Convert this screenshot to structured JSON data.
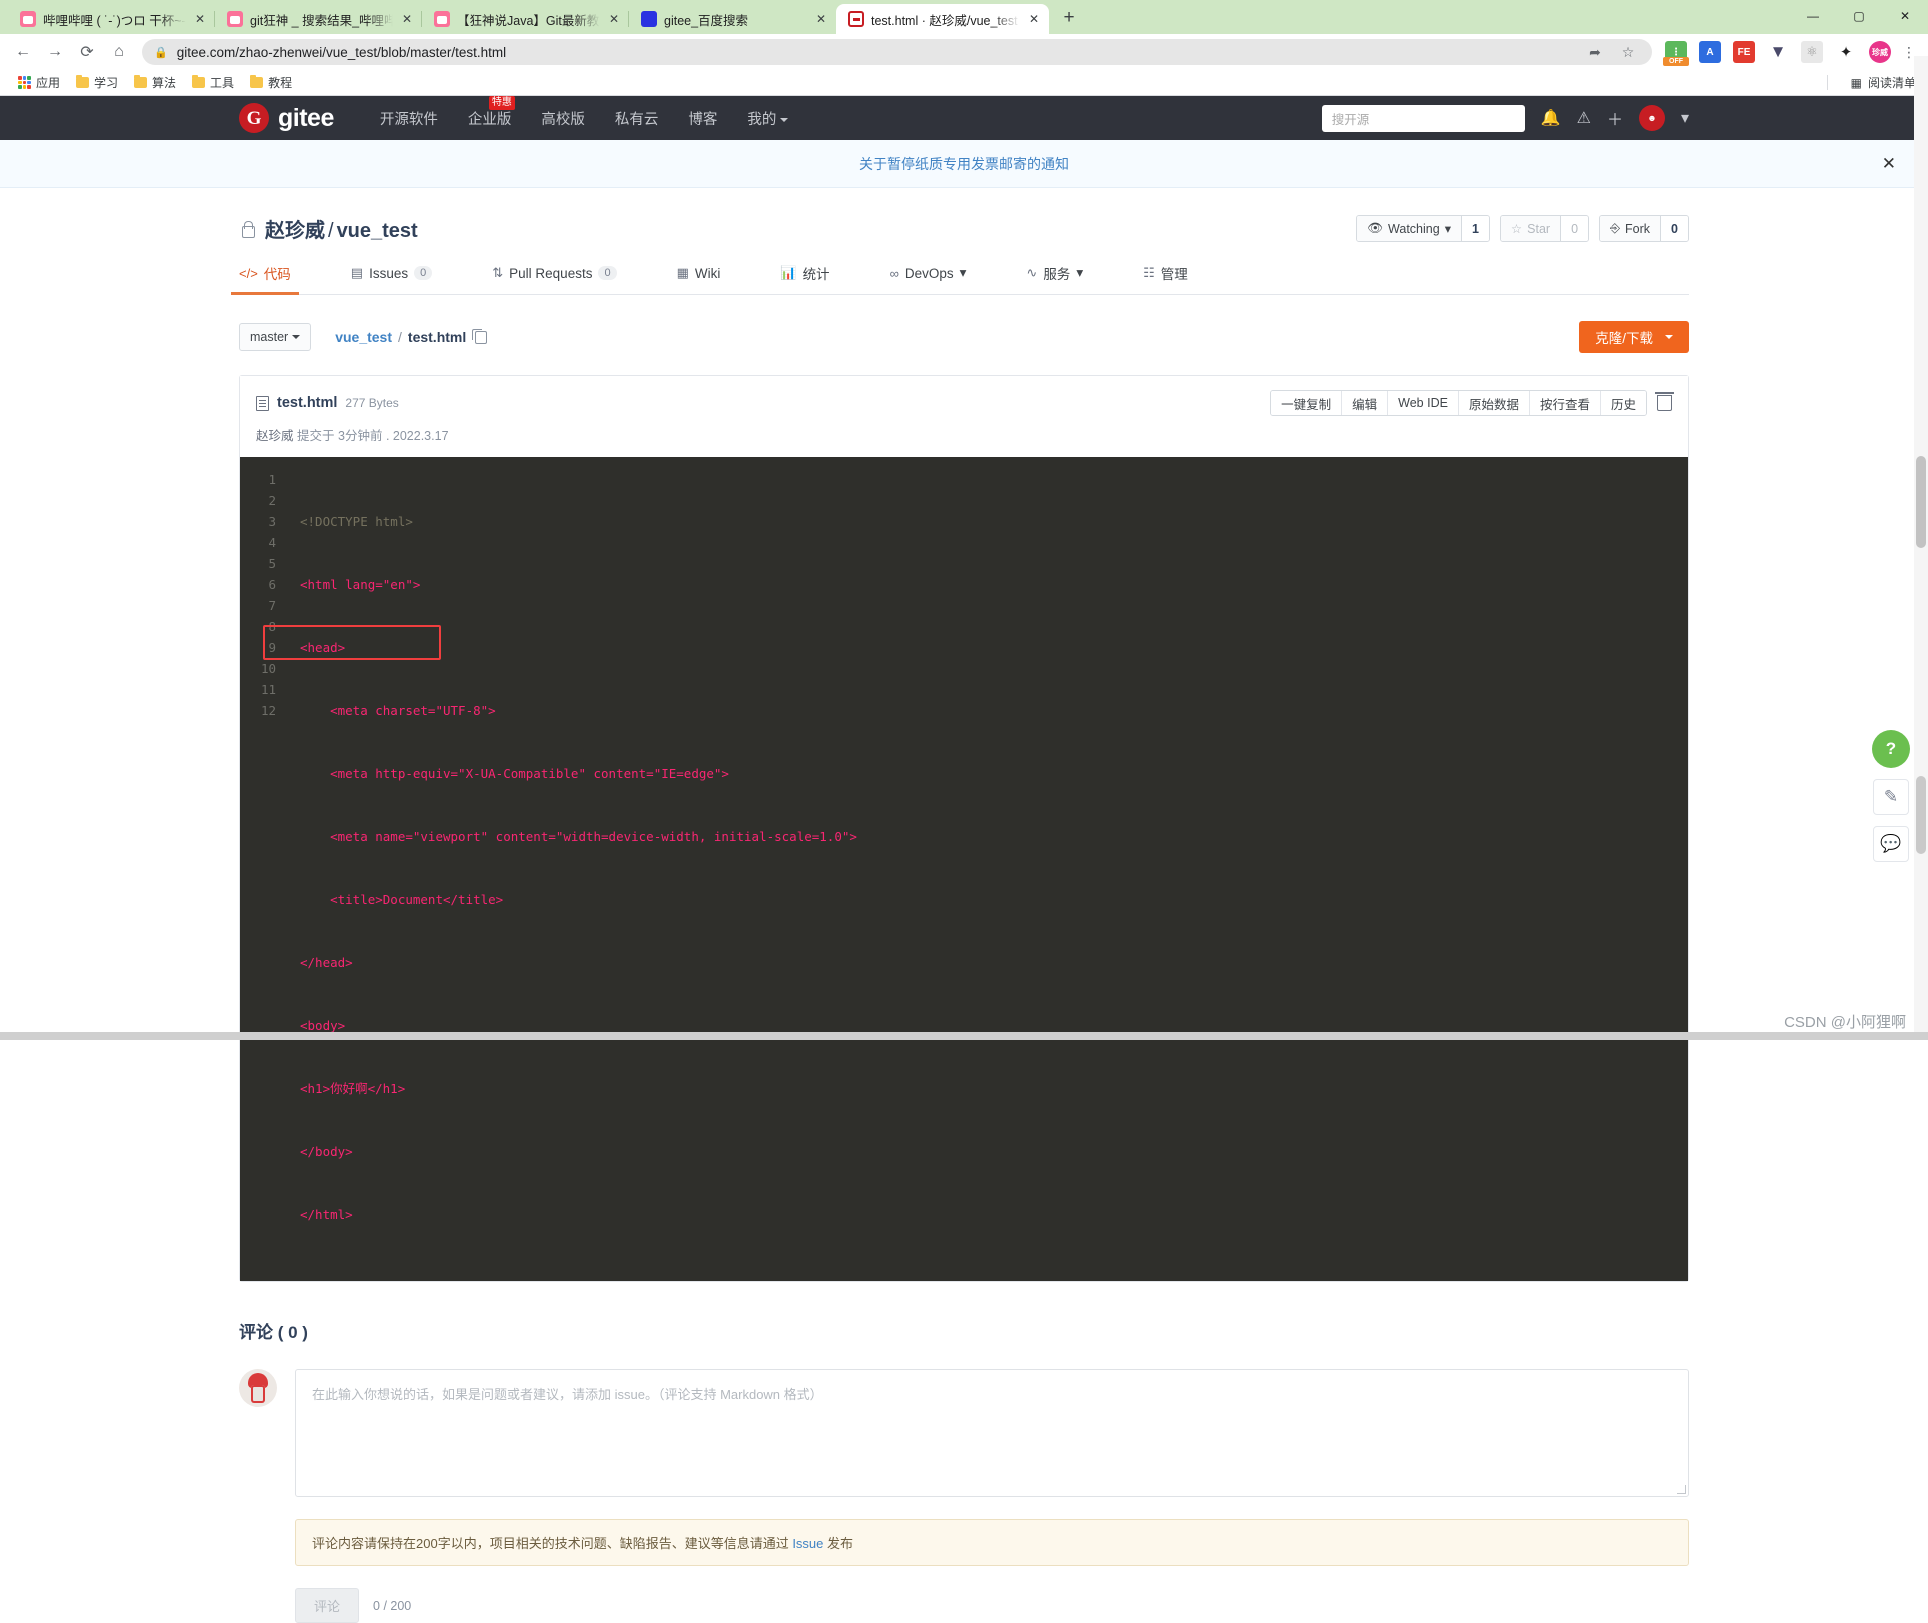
{
  "browser": {
    "tabs": [
      {
        "title": "哔哩哔哩 ( ˙-˙)つロ 干杯~-bili",
        "favicon": "bilibili-icon",
        "active": false
      },
      {
        "title": "git狂神 _ 搜索结果_哔哩哔哩_Bil",
        "favicon": "bilibili-icon",
        "active": false
      },
      {
        "title": "【狂神说Java】Git最新教程通俗",
        "favicon": "bilibili-icon",
        "active": false
      },
      {
        "title": "gitee_百度搜索",
        "favicon": "baidu-icon",
        "active": false
      },
      {
        "title": "test.html · 赵珍威/vue_test - 码",
        "favicon": "gitee-icon",
        "active": true
      }
    ],
    "new_tab_label": "+",
    "close_label": "✕",
    "window_buttons": [
      "—",
      "▢",
      "✕"
    ],
    "nav": {
      "back": "←",
      "forward": "→",
      "reload": "⟳",
      "home": "⌂"
    },
    "omnibox": {
      "lock": "🔒",
      "url": "gitee.com/zhao-zhenwei/vue_test/blob/master/test.html",
      "share": "share-icon",
      "star": "☆"
    },
    "extensions": [
      "off-badge-extension",
      "A-extension",
      "FE-extension",
      "V-extension",
      "atom-extension",
      "puzzle-extension"
    ],
    "profile_label": "珍威",
    "menu_label": "⋮",
    "bookmarks": [
      {
        "label": "应用",
        "icon": "apps-grid-icon"
      },
      {
        "label": "学习",
        "icon": "folder-icon"
      },
      {
        "label": "算法",
        "icon": "folder-icon"
      },
      {
        "label": "工具",
        "icon": "folder-icon"
      },
      {
        "label": "教程",
        "icon": "folder-icon"
      }
    ],
    "reading_list": "阅读清单"
  },
  "gitee_nav": {
    "brand": "gitee",
    "brand_mark": "G",
    "links": [
      {
        "label": "开源软件",
        "badge": ""
      },
      {
        "label": "企业版",
        "badge": "特惠"
      },
      {
        "label": "高校版",
        "badge": ""
      },
      {
        "label": "私有云",
        "badge": ""
      },
      {
        "label": "博客",
        "badge": ""
      },
      {
        "label": "我的",
        "badge": "",
        "has_caret": true
      }
    ],
    "search_placeholder": "搜开源",
    "icons": [
      "bell-icon",
      "message-icon",
      "plus-icon",
      "avatar-icon"
    ],
    "avatar_caret": "▾"
  },
  "notice": {
    "text": "关于暂停纸质专用发票邮寄的通知",
    "close": "✕"
  },
  "repo": {
    "owner": "赵珍威",
    "separator": "/",
    "name": "vue_test",
    "lock_icon": "lock-icon",
    "actions": [
      {
        "name": "watching",
        "icon": "eye-icon",
        "label": "Watching",
        "caret": "▾",
        "count": "1",
        "muted": false
      },
      {
        "name": "star",
        "icon": "☆",
        "label": "Star",
        "count": "0",
        "muted": true
      },
      {
        "name": "fork",
        "icon": "fork-icon",
        "label": "Fork",
        "count": "0",
        "muted": false
      }
    ],
    "tabs": [
      {
        "label": "代码",
        "icon": "code-icon",
        "count": "",
        "active": true
      },
      {
        "label": "Issues",
        "icon": "issue-icon",
        "count": "0",
        "active": false
      },
      {
        "label": "Pull Requests",
        "icon": "pr-icon",
        "count": "0",
        "active": false
      },
      {
        "label": "Wiki",
        "icon": "wiki-icon",
        "count": "",
        "active": false
      },
      {
        "label": "统计",
        "icon": "chart-icon",
        "count": "",
        "active": false
      },
      {
        "label": "DevOps",
        "icon": "devops-icon",
        "count": "",
        "caret": "▾",
        "active": false
      },
      {
        "label": "服务",
        "icon": "service-icon",
        "count": "",
        "caret": "▾",
        "active": false
      },
      {
        "label": "管理",
        "icon": "manage-icon",
        "count": "",
        "active": false
      }
    ]
  },
  "file_toolbar": {
    "branch": "master",
    "branch_caret": "▾",
    "breadcrumb_repo": "vue_test",
    "breadcrumb_slash": "/",
    "breadcrumb_file": "test.html",
    "copy_icon": "copy-icon",
    "clone_label": "克隆/下载",
    "clone_caret": "▾"
  },
  "file": {
    "name": "test.html",
    "size": "277 Bytes",
    "buttons": [
      "一键复制",
      "编辑",
      "Web IDE",
      "原始数据",
      "按行查看",
      "历史"
    ],
    "delete_icon": "trash-icon",
    "commit_author": "赵珍威",
    "commit_verb": "提交于",
    "commit_time": "3分钟前",
    "commit_dot": ".",
    "commit_date": "2022.3.17"
  },
  "code": {
    "language": "html",
    "line_numbers": [
      "1",
      "2",
      "3",
      "4",
      "5",
      "6",
      "7",
      "8",
      "9",
      "10",
      "11",
      "12"
    ],
    "lines": [
      "<!DOCTYPE html>",
      "<html lang=\"en\">",
      "<head>",
      "    <meta charset=\"UTF-8\">",
      "    <meta http-equiv=\"X-UA-Compatible\" content=\"IE=edge\">",
      "    <meta name=\"viewport\" content=\"width=device-width, initial-scale=1.0\">",
      "    <title>Document</title>",
      "</head>",
      "<body>",
      "<h1>你好啊</h1>",
      "</body>",
      "</html>"
    ],
    "highlight_line": 10,
    "highlight_color": "#f03e3e"
  },
  "comments": {
    "title": "评论 ( 0 )",
    "avatar": "user-avatar",
    "textarea_placeholder": "在此输入你想说的话，如果是问题或者建议，请添加 issue。（评论支持 Markdown 格式）",
    "hint_before": "评论内容请保持在200字以内，项目相关的技术问题、缺陷报告、建议等信息请通过 ",
    "hint_link": "Issue",
    "hint_after": " 发布",
    "submit_label": "评论",
    "counter": "0 / 200"
  },
  "floating": {
    "help": "?",
    "edit": "✎",
    "chat": "💬"
  },
  "watermark": "CSDN @小阿狸啊"
}
